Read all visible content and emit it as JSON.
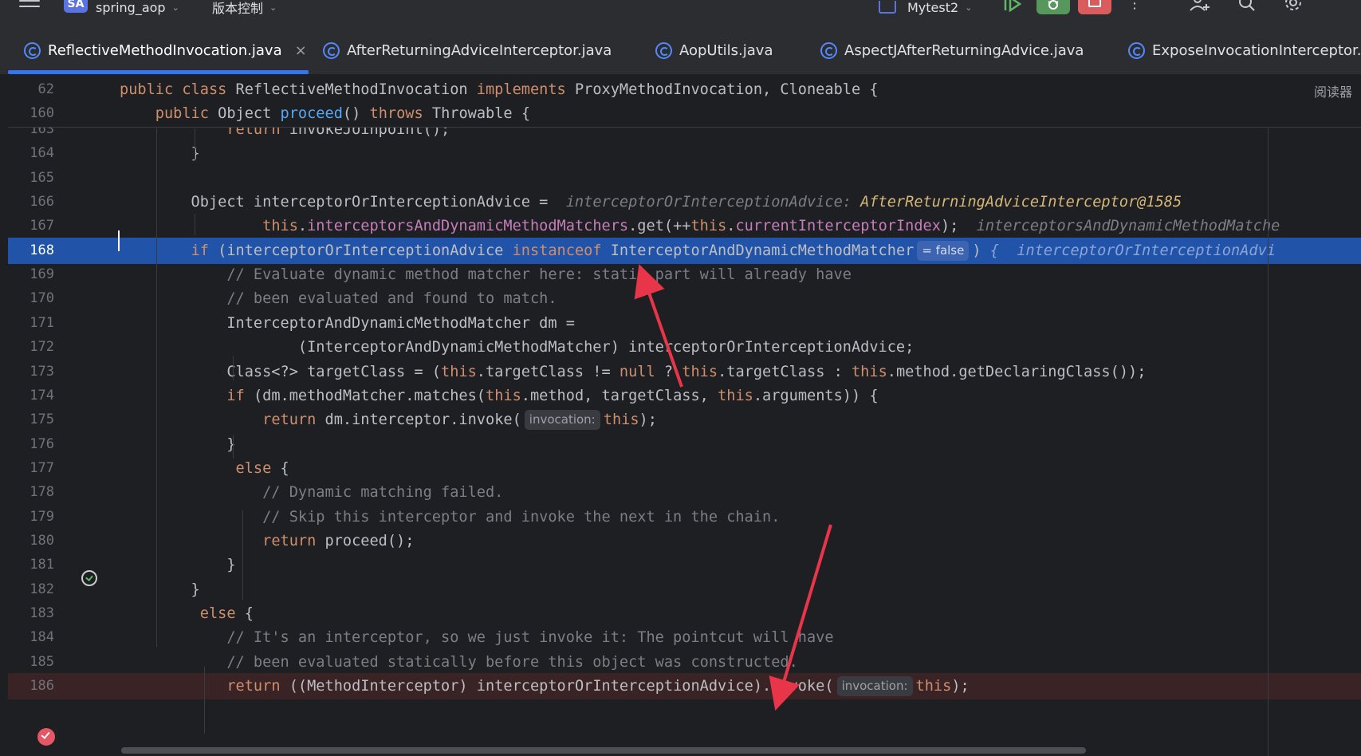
{
  "toolbar": {
    "project_badge": "SA",
    "project_name": "spring_aop",
    "vcs_label": "版本控制",
    "run_config": "Mytest2"
  },
  "tabs": [
    {
      "label": "ReflectiveMethodInvocation.java",
      "active": true
    },
    {
      "label": "AfterReturningAdviceInterceptor.java"
    },
    {
      "label": "AopUtils.java"
    },
    {
      "label": "AspectJAfterReturningAdvice.java"
    },
    {
      "label": "ExposeInvocationInterceptor.ja"
    }
  ],
  "reader_mode_label": "阅读器",
  "sticky": [
    {
      "ln": "62",
      "code": [
        [
          "kw",
          "public "
        ],
        [
          "kw",
          "class "
        ],
        [
          "",
          "ReflectiveMethodInvocation "
        ],
        [
          "kw",
          "implements "
        ],
        [
          "",
          "ProxyMethodInvocation, Cloneable {"
        ]
      ]
    },
    {
      "ln": "160",
      "code": [
        [
          "",
          "    "
        ],
        [
          "kw",
          "public "
        ],
        [
          "",
          "Object "
        ],
        [
          "fn",
          "proceed"
        ],
        [
          "",
          "() "
        ],
        [
          "kw",
          "throws "
        ],
        [
          "",
          "Throwable {"
        ]
      ]
    }
  ],
  "lines": [
    {
      "ln": "163",
      "code": [
        [
          "",
          "            "
        ],
        [
          "kw",
          "return "
        ],
        [
          "",
          "invokeJoinpoint();"
        ]
      ]
    },
    {
      "ln": "164",
      "code": [
        [
          "",
          "        }"
        ]
      ]
    },
    {
      "ln": "165",
      "code": [
        [
          "",
          ""
        ]
      ]
    },
    {
      "ln": "166",
      "code": [
        [
          "",
          "        Object interceptorOrInterceptionAdvice =  "
        ],
        [
          "hint-i",
          "interceptorOrInterceptionAdvice: "
        ],
        [
          "hint-v",
          "AfterReturningAdviceInterceptor@1585"
        ]
      ]
    },
    {
      "ln": "167",
      "code": [
        [
          "",
          "                "
        ],
        [
          "kw",
          "this"
        ],
        [
          "",
          "."
        ],
        [
          "fld",
          "interceptorsAndDynamicMethodMatchers"
        ],
        [
          "",
          ".get(++"
        ],
        [
          "kw",
          "this"
        ],
        [
          "",
          "."
        ],
        [
          "fld",
          "currentInterceptorIndex"
        ],
        [
          "",
          ");  "
        ],
        [
          "hint-i",
          "interceptorsAndDynamicMethodMatche"
        ]
      ]
    },
    {
      "ln": "168",
      "exec": true,
      "code": [
        [
          "",
          "        "
        ],
        [
          "kw",
          "if "
        ],
        [
          "",
          "(interceptorOrInterceptionAdvice "
        ],
        [
          "kw",
          "instanceof "
        ],
        [
          "",
          "InterceptorAndDynamicMethodMatcher"
        ],
        [
          "pill",
          "= false"
        ],
        [
          "",
          ") "
        ],
        [
          "hint-i",
          "{  interceptorOrInterceptionAdvi"
        ]
      ]
    },
    {
      "ln": "169",
      "code": [
        [
          "cm",
          "            // Evaluate dynamic method matcher here: static part will already have"
        ]
      ]
    },
    {
      "ln": "170",
      "code": [
        [
          "cm",
          "            // been evaluated and found to match."
        ]
      ]
    },
    {
      "ln": "171",
      "code": [
        [
          "",
          "            InterceptorAndDynamicMethodMatcher dm ="
        ]
      ]
    },
    {
      "ln": "172",
      "code": [
        [
          "",
          "                    (InterceptorAndDynamicMethodMatcher) interceptorOrInterceptionAdvice;"
        ]
      ]
    },
    {
      "ln": "173",
      "code": [
        [
          "",
          "            Class<?> targetClass = ("
        ],
        [
          "kw",
          "this"
        ],
        [
          "",
          ".targetClass != "
        ],
        [
          "kw",
          "null"
        ],
        [
          "",
          " ? "
        ],
        [
          "kw",
          "this"
        ],
        [
          "",
          ".targetClass : "
        ],
        [
          "kw",
          "this"
        ],
        [
          "",
          ".method.getDeclaringClass());"
        ]
      ]
    },
    {
      "ln": "174",
      "code": [
        [
          "",
          "            "
        ],
        [
          "kw",
          "if "
        ],
        [
          "",
          "(dm.methodMatcher.matches("
        ],
        [
          "kw",
          "this"
        ],
        [
          "",
          ".method, targetClass, "
        ],
        [
          "kw",
          "this"
        ],
        [
          "",
          ".arguments)) {"
        ]
      ]
    },
    {
      "ln": "175",
      "code": [
        [
          "",
          "                "
        ],
        [
          "kw",
          "return "
        ],
        [
          "",
          "dm.interceptor.invoke("
        ],
        [
          "pill",
          "invocation:"
        ],
        [
          "kw",
          "this"
        ],
        [
          "",
          ");"
        ]
      ]
    },
    {
      "ln": "176",
      "code": [
        [
          "",
          "            }"
        ]
      ]
    },
    {
      "ln": "177",
      "code": [
        [
          "",
          "             "
        ],
        [
          "kw",
          "else "
        ],
        [
          "",
          "{"
        ]
      ]
    },
    {
      "ln": "178",
      "code": [
        [
          "cm",
          "                // Dynamic matching failed."
        ]
      ]
    },
    {
      "ln": "179",
      "code": [
        [
          "cm",
          "                // Skip this interceptor and invoke the next in the chain."
        ]
      ]
    },
    {
      "ln": "180",
      "code": [
        [
          "",
          "                "
        ],
        [
          "kw",
          "return "
        ],
        [
          "",
          "proceed();"
        ]
      ]
    },
    {
      "ln": "181",
      "code": [
        [
          "",
          "            }"
        ]
      ]
    },
    {
      "ln": "182",
      "code": [
        [
          "",
          "        }"
        ]
      ]
    },
    {
      "ln": "183",
      "code": [
        [
          "",
          "         "
        ],
        [
          "kw",
          "else "
        ],
        [
          "",
          "{"
        ]
      ]
    },
    {
      "ln": "184",
      "code": [
        [
          "cm",
          "            // It's an interceptor, so we just invoke it: The pointcut will have"
        ]
      ]
    },
    {
      "ln": "185",
      "code": [
        [
          "cm",
          "            // been evaluated statically before this object was constructed."
        ]
      ]
    },
    {
      "ln": "186",
      "bp": true,
      "code": [
        [
          "",
          "            "
        ],
        [
          "kw",
          "return "
        ],
        [
          "",
          "((MethodInterceptor) interceptorOrInterceptionAdvice).invoke("
        ],
        [
          "pill",
          "invocation:"
        ],
        [
          "kw",
          "this"
        ],
        [
          "",
          ");"
        ]
      ]
    }
  ],
  "colors": {
    "accent": "#3574f0",
    "exec_line": "#2154a8",
    "annotation_arrow": "#e8354a"
  }
}
